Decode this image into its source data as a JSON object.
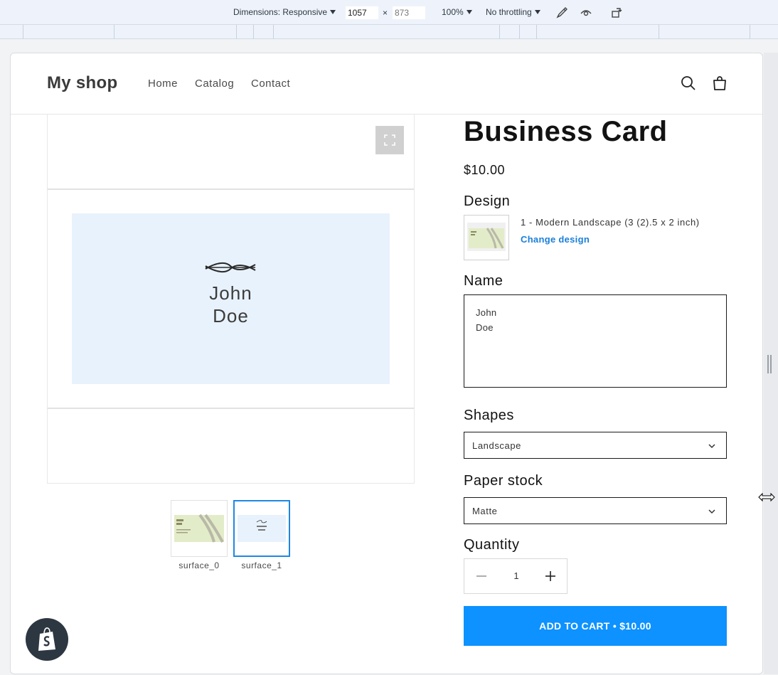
{
  "devtools": {
    "dimensions_label": "Dimensions: Responsive",
    "width_value": "1057",
    "times": "×",
    "height_value": "873",
    "zoom": "100%",
    "throttling": "No throttling"
  },
  "header": {
    "logo": "My shop",
    "nav": [
      "Home",
      "Catalog",
      "Contact"
    ]
  },
  "product": {
    "title": "Business Card",
    "price": "$10.00",
    "design_label": "Design",
    "design_name": "1 - Modern Landscape (3 (2).5 x 2 inch)",
    "change_design": "Change design",
    "name_label": "Name",
    "name_line1": "John",
    "name_line2": "Doe",
    "shapes_label": "Shapes",
    "shapes_value": "Landscape",
    "paper_label": "Paper stock",
    "paper_value": "Matte",
    "quantity_label": "Quantity",
    "quantity_value": "1",
    "add_to_cart": "ADD TO CART • $10.00"
  },
  "media": {
    "card_line1": "John",
    "card_line2": "Doe",
    "thumbnails": [
      {
        "label": "surface_0",
        "mini_line1": "John",
        "mini_line2": "Doe"
      },
      {
        "label": "surface_1",
        "mini_line1": "John",
        "mini_line2": "Doe"
      }
    ]
  },
  "colors": {
    "accent": "#0d92ff",
    "link": "#1a7fd9",
    "card_bg": "#e8f2fc",
    "thumb_card_bg": "#e3ecc8"
  }
}
